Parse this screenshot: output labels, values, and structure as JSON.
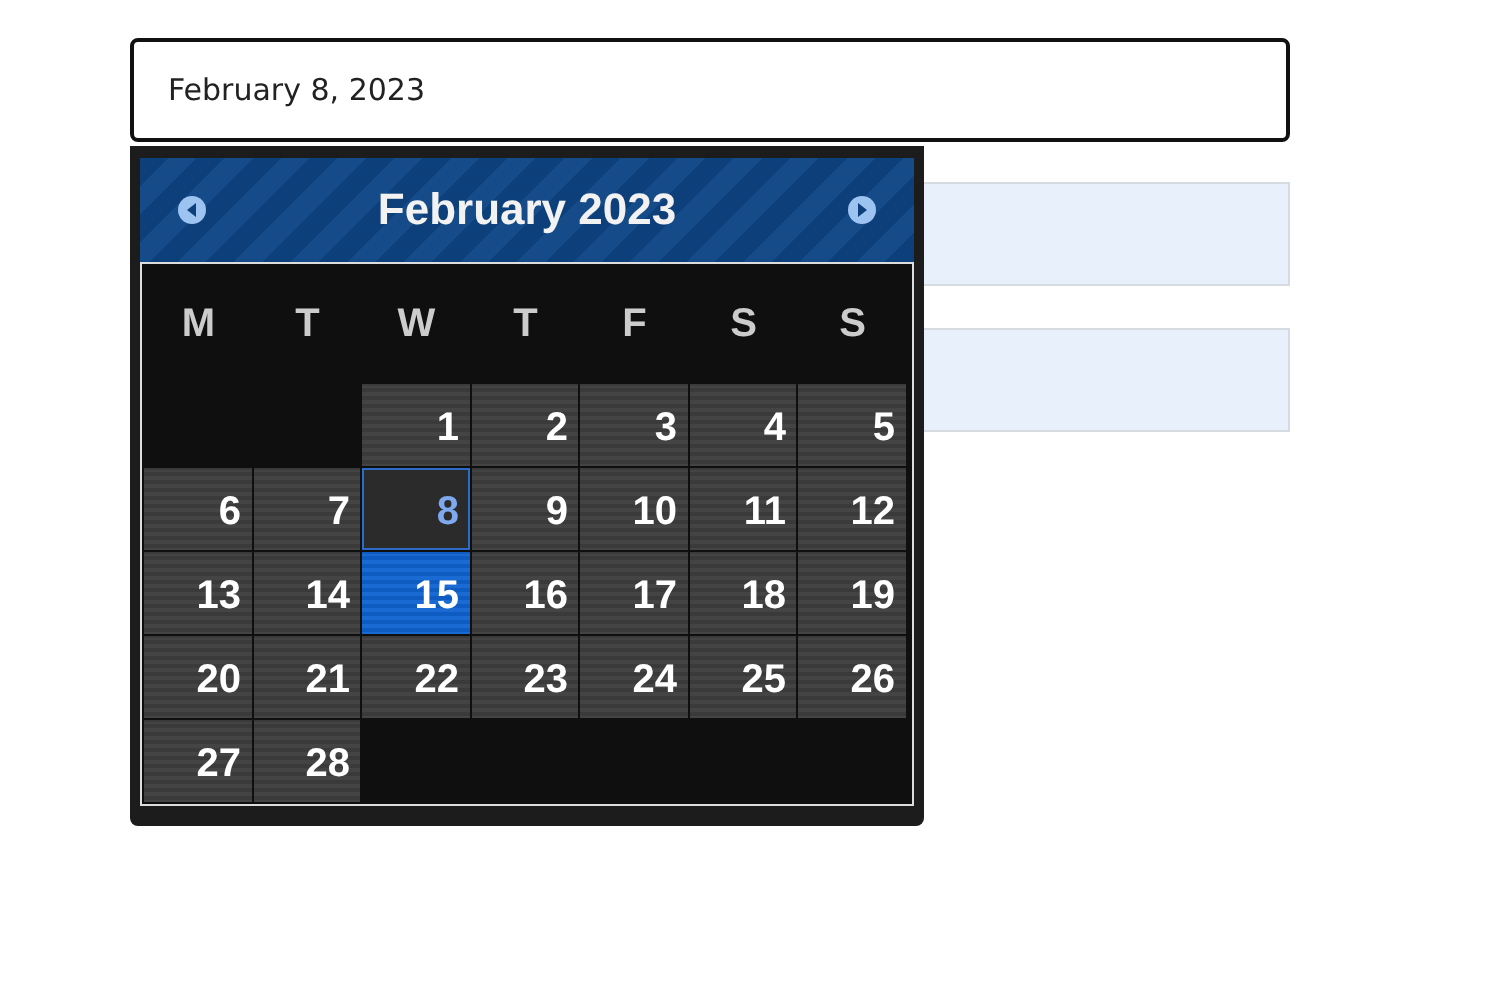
{
  "date_input": {
    "value": "February 8, 2023"
  },
  "calendar": {
    "title": "February 2023",
    "weekdays": [
      "M",
      "T",
      "W",
      "T",
      "F",
      "S",
      "S"
    ],
    "weeks": [
      [
        {
          "kind": "blank"
        },
        {
          "kind": "blank"
        },
        {
          "kind": "day",
          "label": "1",
          "today": false,
          "selected": false
        },
        {
          "kind": "day",
          "label": "2",
          "today": false,
          "selected": false
        },
        {
          "kind": "day",
          "label": "3",
          "today": false,
          "selected": false
        },
        {
          "kind": "day",
          "label": "4",
          "today": false,
          "selected": false
        },
        {
          "kind": "day",
          "label": "5",
          "today": false,
          "selected": false
        }
      ],
      [
        {
          "kind": "day",
          "label": "6",
          "today": false,
          "selected": false
        },
        {
          "kind": "day",
          "label": "7",
          "today": false,
          "selected": false
        },
        {
          "kind": "day",
          "label": "8",
          "today": true,
          "selected": false
        },
        {
          "kind": "day",
          "label": "9",
          "today": false,
          "selected": false
        },
        {
          "kind": "day",
          "label": "10",
          "today": false,
          "selected": false
        },
        {
          "kind": "day",
          "label": "11",
          "today": false,
          "selected": false
        },
        {
          "kind": "day",
          "label": "12",
          "today": false,
          "selected": false
        }
      ],
      [
        {
          "kind": "day",
          "label": "13",
          "today": false,
          "selected": false
        },
        {
          "kind": "day",
          "label": "14",
          "today": false,
          "selected": false
        },
        {
          "kind": "day",
          "label": "15",
          "today": false,
          "selected": true
        },
        {
          "kind": "day",
          "label": "16",
          "today": false,
          "selected": false
        },
        {
          "kind": "day",
          "label": "17",
          "today": false,
          "selected": false
        },
        {
          "kind": "day",
          "label": "18",
          "today": false,
          "selected": false
        },
        {
          "kind": "day",
          "label": "19",
          "today": false,
          "selected": false
        }
      ],
      [
        {
          "kind": "day",
          "label": "20",
          "today": false,
          "selected": false
        },
        {
          "kind": "day",
          "label": "21",
          "today": false,
          "selected": false
        },
        {
          "kind": "day",
          "label": "22",
          "today": false,
          "selected": false
        },
        {
          "kind": "day",
          "label": "23",
          "today": false,
          "selected": false
        },
        {
          "kind": "day",
          "label": "24",
          "today": false,
          "selected": false
        },
        {
          "kind": "day",
          "label": "25",
          "today": false,
          "selected": false
        },
        {
          "kind": "day",
          "label": "26",
          "today": false,
          "selected": false
        }
      ],
      [
        {
          "kind": "day",
          "label": "27",
          "today": false,
          "selected": false
        },
        {
          "kind": "day",
          "label": "28",
          "today": false,
          "selected": false
        },
        {
          "kind": "blank"
        },
        {
          "kind": "blank"
        },
        {
          "kind": "blank"
        },
        {
          "kind": "blank"
        },
        {
          "kind": "blank"
        }
      ]
    ]
  }
}
